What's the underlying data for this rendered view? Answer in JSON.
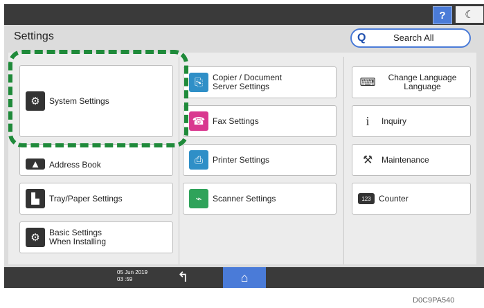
{
  "header": {
    "help_label": "?",
    "moon_label": "☾"
  },
  "page": {
    "title": "Settings",
    "search_label": "Search All",
    "search_icon": "Q"
  },
  "left_column": [
    {
      "label": "System Settings",
      "icon": "gears"
    },
    {
      "label": "Address Book",
      "icon": "address-book"
    },
    {
      "label": "Tray/Paper Settings",
      "icon": "tray"
    },
    {
      "label_line1": "Basic Settings",
      "label_line2": "When Installing",
      "icon": "setup"
    }
  ],
  "middle_column": [
    {
      "label_line1": "Copier / Document",
      "label_line2": "Server Settings",
      "icon": "copier"
    },
    {
      "label": "Fax Settings",
      "icon": "fax"
    },
    {
      "label": "Printer Settings",
      "icon": "printer"
    },
    {
      "label": "Scanner Settings",
      "icon": "scanner"
    }
  ],
  "right_column": [
    {
      "label_line1": "Change Language",
      "label_line2": "Language",
      "icon": "language"
    },
    {
      "label": "Inquiry",
      "icon": "info"
    },
    {
      "label": "Maintenance",
      "icon": "wrench"
    },
    {
      "label": "Counter",
      "icon": "counter",
      "icon_text": "123"
    }
  ],
  "footer": {
    "date": "05 Jun 2019",
    "time": "03 :59"
  },
  "figure_code": "D0C9PA540"
}
